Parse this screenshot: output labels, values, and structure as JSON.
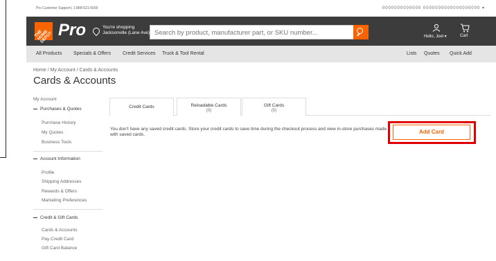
{
  "support": {
    "text": "Pro Customer Support | 1-888-521-5000",
    "right_text": "0000000000000 0000000000000000000 ▾"
  },
  "header": {
    "logo_text": "THE HOME DEPOT",
    "pro_label": "Pro",
    "store_line1": "You're shopping",
    "store_line2": "Jacksonville (Lane Ave)",
    "search_placeholder": "Search by product, manufacturer part, or SKU number...",
    "account_label": "Hello, Joel ▾",
    "cart_label": "Cart"
  },
  "nav": [
    "All Products",
    "Specials & Offers",
    "Credit Services",
    "Truck & Tool Rental",
    "Lists",
    "Quotes",
    "Quick Add"
  ],
  "breadcrumb": "Home  /  My Account  /  Cards & Accounts",
  "page_title": "Cards & Accounts",
  "sidebar": {
    "my_account": "My Account",
    "sections": [
      {
        "title": "Purchases & Quotes",
        "items": [
          "Purchase History",
          "My Quotes",
          "Business Tools"
        ]
      },
      {
        "title": "Account Information",
        "items": [
          "Profile",
          "Shipping Addresses",
          "Rewards & Offers",
          "Marketing Preferences"
        ]
      },
      {
        "title": "Credit & Gift Cards",
        "items": [
          "Cards & Accounts",
          "Pay Credit Card",
          "Gift Card Balance"
        ]
      }
    ]
  },
  "tabs": [
    {
      "label": "Credit Cards",
      "count": ""
    },
    {
      "label": "Reloadable Cards",
      "count": "(0)"
    },
    {
      "label": "Gift Cards",
      "count": "(0)"
    }
  ],
  "message": "You don't have any saved credit cards. Store your credit cards to save time during the checkout process and view in-store purchases made with saved cards.",
  "add_card_label": "Add Card",
  "colors": {
    "brand_orange": "#f96302",
    "header_dark": "#3c3c3c",
    "highlight_red": "#e00000"
  }
}
